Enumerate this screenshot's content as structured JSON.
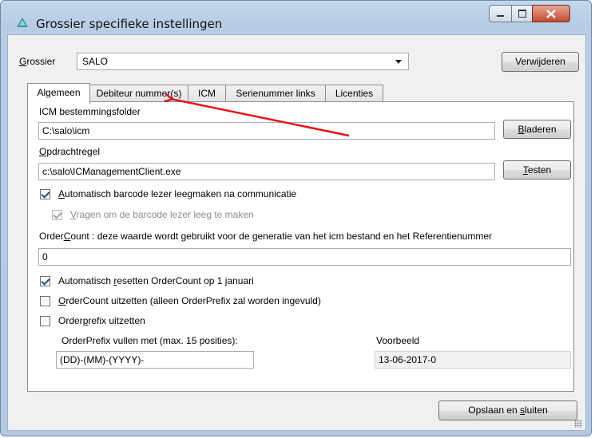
{
  "window": {
    "title": "Grossier specifieke instellingen",
    "close_color": "#c24a33"
  },
  "grossier": {
    "label": "Grossier",
    "value": "SALO",
    "delete_button": "Verwijderen"
  },
  "tabs": [
    "Algemeen",
    "Debiteur nummer(s)",
    "ICM",
    "Serienummer links",
    "Licenties"
  ],
  "general": {
    "icm_folder_label": "ICM bestemmingsfolder",
    "icm_folder_value": "C:\\salo\\icm",
    "browse_button": "Bladeren",
    "command_label": "Opdrachtregel",
    "command_value": "c:\\salo\\ICManagementClient.exe",
    "test_button": "Testen",
    "auto_clear_label": "Automatisch barcode lezer leegmaken na communicatie",
    "ask_clear_label": "Vragen om de barcode lezer leeg te maken",
    "ordercount_label": "OrderCount : deze waarde wordt gebruikt voor de generatie van het icm bestand en het Referentienummer",
    "ordercount_value": "0",
    "auto_reset_label": "Automatisch resetten OrderCount op 1 januari",
    "ordercount_off_label": "OrderCount uitzetten (alleen OrderPrefix zal worden ingevuld)",
    "orderprefix_off_label": "Orderprefix uitzetten",
    "orderprefix_fill_label": "OrderPrefix vullen met (max. 15 posities):",
    "orderprefix_value": "(DD)-(MM)-(YYYY)-",
    "example_label": "Voorbeeld",
    "example_value": "13-06-2017-0"
  },
  "footer": {
    "save_close_button": "Opslaan en sluiten"
  },
  "annotation_color": "#e8121b"
}
